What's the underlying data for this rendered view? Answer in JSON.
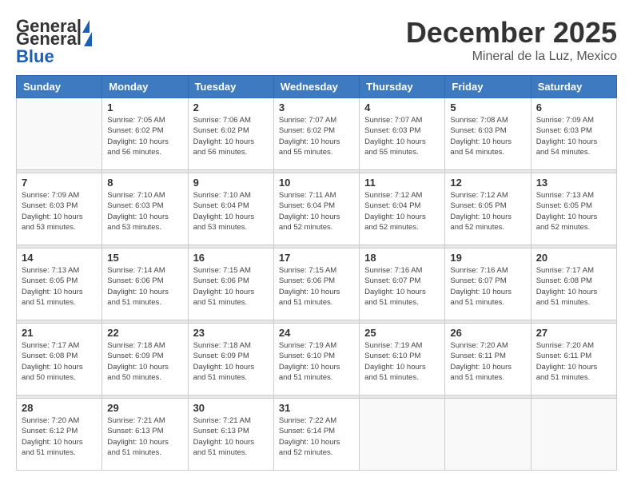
{
  "logo": {
    "general": "General",
    "blue": "Blue"
  },
  "title": {
    "month_year": "December 2025",
    "location": "Mineral de la Luz, Mexico"
  },
  "days_of_week": [
    "Sunday",
    "Monday",
    "Tuesday",
    "Wednesday",
    "Thursday",
    "Friday",
    "Saturday"
  ],
  "weeks": [
    [
      {
        "day": "",
        "info": ""
      },
      {
        "day": "1",
        "info": "Sunrise: 7:05 AM\nSunset: 6:02 PM\nDaylight: 10 hours\nand 56 minutes."
      },
      {
        "day": "2",
        "info": "Sunrise: 7:06 AM\nSunset: 6:02 PM\nDaylight: 10 hours\nand 56 minutes."
      },
      {
        "day": "3",
        "info": "Sunrise: 7:07 AM\nSunset: 6:02 PM\nDaylight: 10 hours\nand 55 minutes."
      },
      {
        "day": "4",
        "info": "Sunrise: 7:07 AM\nSunset: 6:03 PM\nDaylight: 10 hours\nand 55 minutes."
      },
      {
        "day": "5",
        "info": "Sunrise: 7:08 AM\nSunset: 6:03 PM\nDaylight: 10 hours\nand 54 minutes."
      },
      {
        "day": "6",
        "info": "Sunrise: 7:09 AM\nSunset: 6:03 PM\nDaylight: 10 hours\nand 54 minutes."
      }
    ],
    [
      {
        "day": "7",
        "info": "Sunrise: 7:09 AM\nSunset: 6:03 PM\nDaylight: 10 hours\nand 53 minutes."
      },
      {
        "day": "8",
        "info": "Sunrise: 7:10 AM\nSunset: 6:03 PM\nDaylight: 10 hours\nand 53 minutes."
      },
      {
        "day": "9",
        "info": "Sunrise: 7:10 AM\nSunset: 6:04 PM\nDaylight: 10 hours\nand 53 minutes."
      },
      {
        "day": "10",
        "info": "Sunrise: 7:11 AM\nSunset: 6:04 PM\nDaylight: 10 hours\nand 52 minutes."
      },
      {
        "day": "11",
        "info": "Sunrise: 7:12 AM\nSunset: 6:04 PM\nDaylight: 10 hours\nand 52 minutes."
      },
      {
        "day": "12",
        "info": "Sunrise: 7:12 AM\nSunset: 6:05 PM\nDaylight: 10 hours\nand 52 minutes."
      },
      {
        "day": "13",
        "info": "Sunrise: 7:13 AM\nSunset: 6:05 PM\nDaylight: 10 hours\nand 52 minutes."
      }
    ],
    [
      {
        "day": "14",
        "info": "Sunrise: 7:13 AM\nSunset: 6:05 PM\nDaylight: 10 hours\nand 51 minutes."
      },
      {
        "day": "15",
        "info": "Sunrise: 7:14 AM\nSunset: 6:06 PM\nDaylight: 10 hours\nand 51 minutes."
      },
      {
        "day": "16",
        "info": "Sunrise: 7:15 AM\nSunset: 6:06 PM\nDaylight: 10 hours\nand 51 minutes."
      },
      {
        "day": "17",
        "info": "Sunrise: 7:15 AM\nSunset: 6:06 PM\nDaylight: 10 hours\nand 51 minutes."
      },
      {
        "day": "18",
        "info": "Sunrise: 7:16 AM\nSunset: 6:07 PM\nDaylight: 10 hours\nand 51 minutes."
      },
      {
        "day": "19",
        "info": "Sunrise: 7:16 AM\nSunset: 6:07 PM\nDaylight: 10 hours\nand 51 minutes."
      },
      {
        "day": "20",
        "info": "Sunrise: 7:17 AM\nSunset: 6:08 PM\nDaylight: 10 hours\nand 51 minutes."
      }
    ],
    [
      {
        "day": "21",
        "info": "Sunrise: 7:17 AM\nSunset: 6:08 PM\nDaylight: 10 hours\nand 50 minutes."
      },
      {
        "day": "22",
        "info": "Sunrise: 7:18 AM\nSunset: 6:09 PM\nDaylight: 10 hours\nand 50 minutes."
      },
      {
        "day": "23",
        "info": "Sunrise: 7:18 AM\nSunset: 6:09 PM\nDaylight: 10 hours\nand 51 minutes."
      },
      {
        "day": "24",
        "info": "Sunrise: 7:19 AM\nSunset: 6:10 PM\nDaylight: 10 hours\nand 51 minutes."
      },
      {
        "day": "25",
        "info": "Sunrise: 7:19 AM\nSunset: 6:10 PM\nDaylight: 10 hours\nand 51 minutes."
      },
      {
        "day": "26",
        "info": "Sunrise: 7:20 AM\nSunset: 6:11 PM\nDaylight: 10 hours\nand 51 minutes."
      },
      {
        "day": "27",
        "info": "Sunrise: 7:20 AM\nSunset: 6:11 PM\nDaylight: 10 hours\nand 51 minutes."
      }
    ],
    [
      {
        "day": "28",
        "info": "Sunrise: 7:20 AM\nSunset: 6:12 PM\nDaylight: 10 hours\nand 51 minutes."
      },
      {
        "day": "29",
        "info": "Sunrise: 7:21 AM\nSunset: 6:13 PM\nDaylight: 10 hours\nand 51 minutes."
      },
      {
        "day": "30",
        "info": "Sunrise: 7:21 AM\nSunset: 6:13 PM\nDaylight: 10 hours\nand 51 minutes."
      },
      {
        "day": "31",
        "info": "Sunrise: 7:22 AM\nSunset: 6:14 PM\nDaylight: 10 hours\nand 52 minutes."
      },
      {
        "day": "",
        "info": ""
      },
      {
        "day": "",
        "info": ""
      },
      {
        "day": "",
        "info": ""
      }
    ]
  ]
}
